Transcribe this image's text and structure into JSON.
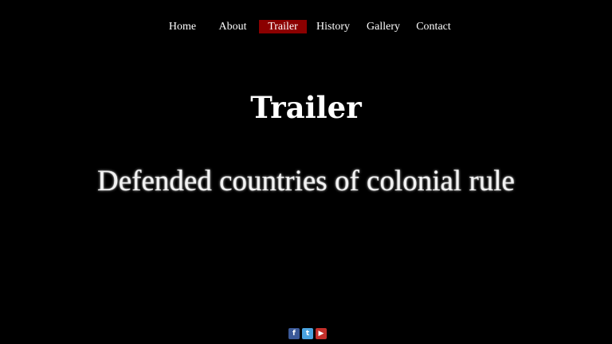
{
  "nav": {
    "items": [
      {
        "label": "Home"
      },
      {
        "label": "About"
      },
      {
        "label": "Trailer",
        "active": true
      },
      {
        "label": "History"
      },
      {
        "label": "Gallery"
      },
      {
        "label": "Contact"
      }
    ],
    "active_color": "#8b0000"
  },
  "main": {
    "title": "Trailer",
    "video": {
      "caption": "Defended countries of colonial rule"
    }
  },
  "social": {
    "icons": [
      {
        "name": "facebook-icon",
        "glyph": "f"
      },
      {
        "name": "twitter-icon",
        "glyph": "t"
      },
      {
        "name": "youtube-icon",
        "glyph": "▶"
      }
    ]
  },
  "colors": {
    "background": "#000000",
    "text": "#ffffff"
  }
}
